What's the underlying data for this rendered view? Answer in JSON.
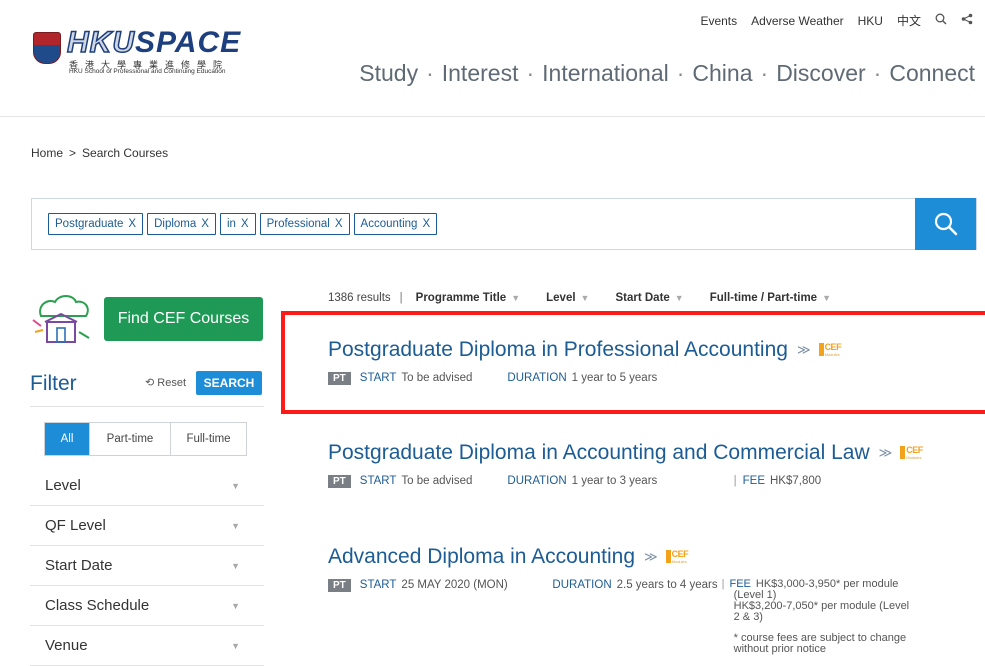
{
  "utility": {
    "events": "Events",
    "weather": "Adverse Weather",
    "hku": "HKU",
    "lang": "中文",
    "search_icon": "search-icon",
    "share_icon": "share-icon"
  },
  "logo": {
    "brand_hku": "HKU",
    "brand_space": "SPACE",
    "chinese": "香港大學專業進修學院",
    "subtitle": "HKU School of Professional and Continuing Education"
  },
  "nav": [
    "Study",
    "Interest",
    "International",
    "China",
    "Discover",
    "Connect"
  ],
  "breadcrumb": {
    "home": "Home",
    "sep": ">",
    "current": "Search Courses"
  },
  "search": {
    "chips": [
      "Postgraduate",
      "Diploma",
      "in",
      "Professional",
      "Accounting"
    ],
    "remove": "X"
  },
  "cef_button": "Find CEF Courses",
  "filter": {
    "title": "Filter",
    "reset": "Reset",
    "search": "SEARCH",
    "segments": [
      "All",
      "Part-time",
      "Full-time"
    ],
    "facets": [
      "Level",
      "QF Level",
      "Start Date",
      "Class Schedule",
      "Venue"
    ]
  },
  "results": {
    "count": "1386 results",
    "sep": "|",
    "sort": [
      "Programme Title",
      "Level",
      "Start Date",
      "Full-time / Part-time"
    ]
  },
  "labels": {
    "start": "START",
    "duration": "DURATION",
    "fee": "FEE",
    "pt": "PT",
    "cef": "CEF",
    "cef_sub": "Modules"
  },
  "courses": [
    {
      "title": "Postgraduate Diploma in Professional Accounting",
      "start": "To be advised",
      "duration": "1 year to 5 years"
    },
    {
      "title": "Postgraduate Diploma in Accounting and Commercial Law",
      "start": "To be advised",
      "duration": "1 year to 3 years",
      "fee": "HK$7,800"
    },
    {
      "title": "Advanced Diploma in Accounting",
      "start": "25 MAY 2020 (MON)",
      "duration": "2.5 years to 4 years",
      "fee_line1": "HK$3,000-3,950* per module",
      "fee_line2": "(Level 1)",
      "fee_line3": "HK$3,200-7,050* per module (Level",
      "fee_line4": "2 & 3)",
      "note1": "* course fees are subject to change",
      "note2": "without prior notice"
    }
  ],
  "colors": {
    "brand_blue": "#1c5c95",
    "accent_blue": "#1d8dd8",
    "cef_green": "#1f9a56",
    "highlight_red": "#ff1a1a",
    "cef_orange": "#f2a21b"
  }
}
